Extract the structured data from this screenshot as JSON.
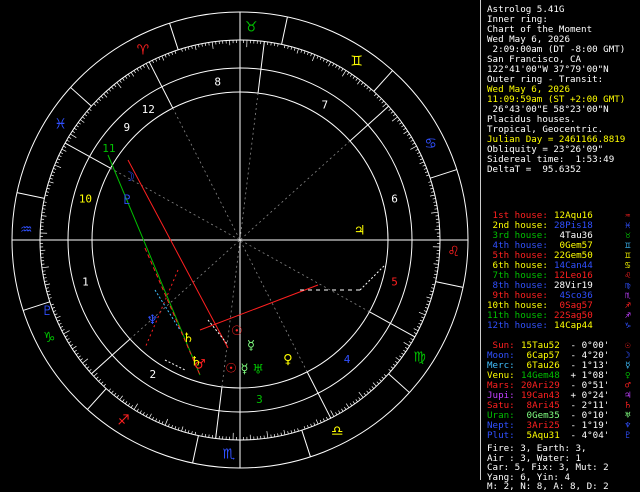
{
  "colors": {
    "white": "#ffffff",
    "yellow": "#ffff00",
    "red": "#ff2020",
    "green": "#00c000",
    "blue": "#3050ff",
    "cyan": "#40c0ff",
    "purple": "#c040ff",
    "gray": "#808080",
    "light_green": "#80ff80"
  },
  "header": {
    "lines": [
      {
        "text": "Astrolog 5.41G",
        "color": "white"
      },
      {
        "text": "Inner ring:",
        "color": "white"
      },
      {
        "text": "Chart of the Moment",
        "color": "white"
      },
      {
        "text": "Wed May 6, 2026",
        "color": "white"
      },
      {
        "text": " 2:09:00am (DT -8:00 GMT)",
        "color": "white"
      },
      {
        "text": "San Francisco, CA",
        "color": "white"
      },
      {
        "text": "122°41'00\"W 37°79'00\"N",
        "color": "white"
      },
      {
        "text": "Outer ring - Transit:",
        "color": "white"
      },
      {
        "text": "Wed May 6, 2026",
        "color": "yellow"
      },
      {
        "text": "11:09:59am (ST +2:00 GMT)",
        "color": "yellow"
      },
      {
        "text": " 26°43'00\"E 58°23'00\"N",
        "color": "white"
      },
      {
        "text": "Placidus houses.",
        "color": "white"
      },
      {
        "text": "Tropical, Geocentric.",
        "color": "white"
      },
      {
        "text": "Julian Day = 2461166.8819",
        "color": "yellow"
      },
      {
        "text": "Obliquity = 23°26'09\"",
        "color": "white"
      },
      {
        "text": "Sidereal time:  1:53:49",
        "color": "white"
      },
      {
        "text": "DeltaT =  95.6352",
        "color": "white"
      }
    ]
  },
  "houses": [
    {
      "label": "1st house:",
      "value": "12Aqu16",
      "label_color": "red",
      "value_color": "yellow",
      "glyph": "♒",
      "glyph_color": "red"
    },
    {
      "label": "2nd house:",
      "value": "28Pis18",
      "label_color": "yellow",
      "value_color": "blue",
      "glyph": "♓",
      "glyph_color": "blue"
    },
    {
      "label": "3rd house:",
      "value": "4Tau36",
      "label_color": "green",
      "value_color": "white",
      "glyph": "♉",
      "glyph_color": "green"
    },
    {
      "label": "4th house:",
      "value": "0Gem57",
      "label_color": "blue",
      "value_color": "yellow",
      "glyph": "♊",
      "glyph_color": "cyan"
    },
    {
      "label": "5th house:",
      "value": "22Gem50",
      "label_color": "red",
      "value_color": "yellow",
      "glyph": "♊",
      "glyph_color": "yellow"
    },
    {
      "label": "6th house:",
      "value": "14Can44",
      "label_color": "yellow",
      "value_color": "blue",
      "glyph": "♋",
      "glyph_color": "yellow"
    },
    {
      "label": "7th house:",
      "value": "12Leo16",
      "label_color": "green",
      "value_color": "red",
      "glyph": "♌",
      "glyph_color": "red"
    },
    {
      "label": "8th house:",
      "value": "28Vir19",
      "label_color": "blue",
      "value_color": "white",
      "glyph": "♍",
      "glyph_color": "blue"
    },
    {
      "label": "9th house:",
      "value": "4Sco36",
      "label_color": "red",
      "value_color": "blue",
      "glyph": "♏",
      "glyph_color": "purple"
    },
    {
      "label": "10th house:",
      "value": "0Sag57",
      "label_color": "yellow",
      "value_color": "red",
      "glyph": "♐",
      "glyph_color": "red"
    },
    {
      "label": "11th house:",
      "value": "22Sag50",
      "label_color": "green",
      "value_color": "red",
      "glyph": "♐",
      "glyph_color": "purple"
    },
    {
      "label": "12th house:",
      "value": "14Cap44",
      "label_color": "blue",
      "value_color": "yellow",
      "glyph": "♑",
      "glyph_color": "blue"
    }
  ],
  "planets": [
    {
      "label": "Sun:",
      "value": "15Tau52",
      "label_color": "red",
      "value_color": "yellow",
      "speed": " - 0°00'",
      "glyph": "☉",
      "glyph_color": "red"
    },
    {
      "label": "Moon:",
      "value": "6Cap57",
      "label_color": "blue",
      "value_color": "yellow",
      "speed": " - 4°20'",
      "glyph": "☽",
      "glyph_color": "blue"
    },
    {
      "label": "Merc:",
      "value": "6Tau26",
      "label_color": "cyan",
      "value_color": "yellow",
      "speed": " - 1°13'",
      "glyph": "☿",
      "glyph_color": "cyan"
    },
    {
      "label": "Venu:",
      "value": "14Gem48",
      "label_color": "yellow",
      "value_color": "green",
      "speed": " + 1°08'",
      "glyph": "♀",
      "glyph_color": "green"
    },
    {
      "label": "Mars:",
      "value": "20Ari29",
      "label_color": "red",
      "value_color": "red",
      "speed": " - 0°51'",
      "glyph": "♂",
      "glyph_color": "red"
    },
    {
      "label": "Jupi:",
      "value": "19Can43",
      "label_color": "purple",
      "value_color": "red",
      "speed": " + 0°24'",
      "glyph": "♃",
      "glyph_color": "purple"
    },
    {
      "label": "Satu:",
      "value": "8Ari45",
      "label_color": "red",
      "value_color": "red",
      "speed": " - 2°11'",
      "glyph": "♄",
      "glyph_color": "red"
    },
    {
      "label": "Uran:",
      "value": "0Gem35",
      "label_color": "green",
      "value_color": "light_green",
      "speed": " - 0°10'",
      "glyph": "♅",
      "glyph_color": "light_green"
    },
    {
      "label": "Nept:",
      "value": "3Ari25",
      "label_color": "blue",
      "value_color": "red",
      "speed": " - 1°19'",
      "glyph": "♆",
      "glyph_color": "blue"
    },
    {
      "label": "Plut:",
      "value": "5Aqu31",
      "label_color": "blue",
      "value_color": "yellow",
      "speed": " - 4°04'",
      "glyph": "♇",
      "glyph_color": "blue"
    }
  ],
  "summary": {
    "lines": [
      "Fire: 3, Earth: 3,",
      "Air : 3, Water: 1",
      "Car: 5, Fix: 3, Mut: 2",
      "Yang: 6, Yin: 4",
      "M: 2, N: 8, A: 8, D: 2"
    ]
  },
  "wheel": {
    "signs": [
      {
        "glyph": "♒",
        "color": "blue"
      },
      {
        "glyph": "♓",
        "color": "blue"
      },
      {
        "glyph": "♈",
        "color": "red"
      },
      {
        "glyph": "♉",
        "color": "green"
      },
      {
        "glyph": "♊",
        "color": "yellow"
      },
      {
        "glyph": "♋",
        "color": "blue"
      },
      {
        "glyph": "♌",
        "color": "red"
      },
      {
        "glyph": "♍",
        "color": "green"
      },
      {
        "glyph": "♎",
        "color": "yellow"
      },
      {
        "glyph": "♏",
        "color": "blue"
      },
      {
        "glyph": "♐",
        "color": "red"
      },
      {
        "glyph": "♑",
        "color": "green"
      }
    ],
    "house_numbers": [
      {
        "n": "1",
        "color": "white"
      },
      {
        "n": "2",
        "color": "white"
      },
      {
        "n": "3",
        "color": "green"
      },
      {
        "n": "4",
        "color": "blue"
      },
      {
        "n": "5",
        "color": "red"
      },
      {
        "n": "6",
        "color": "white"
      },
      {
        "n": "7",
        "color": "white"
      },
      {
        "n": "8",
        "color": "white"
      },
      {
        "n": "9",
        "color": "white"
      },
      {
        "n": "10",
        "color": "yellow"
      },
      {
        "n": "11",
        "color": "green"
      },
      {
        "n": "12",
        "color": "white"
      }
    ]
  }
}
